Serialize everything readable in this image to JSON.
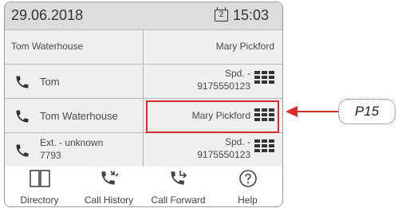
{
  "status": {
    "date": "29.06.2018",
    "calendar_day": "2",
    "time": "15:03"
  },
  "rows": [
    {
      "left": {
        "name": "Tom Waterhouse"
      },
      "right": {
        "name": "Mary Pickford"
      }
    },
    {
      "left": {
        "name": "Tom",
        "icon": "phone-handset-icon"
      },
      "right": {
        "label": "Spd. -",
        "number": "9175550123",
        "icon": "keypad-grid-icon"
      }
    },
    {
      "left": {
        "name": "Tom Waterhouse",
        "icon": "phone-handset-icon"
      },
      "right": {
        "name": "Mary Pickford",
        "icon": "keypad-grid-icon"
      }
    },
    {
      "left": {
        "name": "Ext. - unknown",
        "number": "7793",
        "icon": "phone-handset-icon"
      },
      "right": {
        "label": "Spd. -",
        "number": "9175550123",
        "icon": "keypad-grid-icon"
      }
    }
  ],
  "softkeys": [
    {
      "label": "Directory",
      "icon": "book-icon"
    },
    {
      "label": "Call History",
      "icon": "call-history-icon"
    },
    {
      "label": "Call Forward",
      "icon": "call-forward-icon"
    },
    {
      "label": "Help",
      "icon": "help-icon"
    }
  ],
  "callout": {
    "label": "P15"
  },
  "colors": {
    "highlight": "#d72a2a",
    "statusbar": "#dcdcdc",
    "cell": "#efefef"
  }
}
